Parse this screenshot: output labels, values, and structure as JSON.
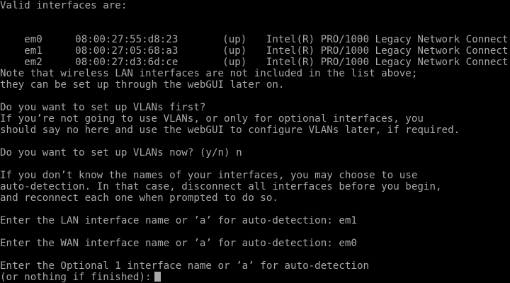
{
  "console": {
    "header": "Valid interfaces are:",
    "interfaces": [
      {
        "name": "em0",
        "mac": "08:00:27:55:d8:23",
        "status": "(up)",
        "desc": "Intel(R) PRO/1000 Legacy Network Connect..."
      },
      {
        "name": "em1",
        "mac": "08:00:27:05:68:a3",
        "status": "(up)",
        "desc": "Intel(R) PRO/1000 Legacy Network Connect..."
      },
      {
        "name": "em2",
        "mac": "08:00:27:d3:6d:ce",
        "status": "(up)",
        "desc": "Intel(R) PRO/1000 Legacy Network Connect..."
      }
    ],
    "wireless_note_1": "Note that wireless LAN interfaces are not included in the list above;",
    "wireless_note_2": "they can be set up through the webGUI later on.",
    "vlan_q1": "Do you want to set up VLANs first?",
    "vlan_q2": "If you’re not going to use VLANs, or only for optional interfaces, you",
    "vlan_q3": "should say no here and use the webGUI to configure VLANs later, if required.",
    "vlan_prompt": "Do you want to set up VLANs now? (y/n) n",
    "auto_1": "If you don’t know the names of your interfaces, you may choose to use",
    "auto_2": "auto-detection. In that case, disconnect all interfaces before you begin,",
    "auto_3": "and reconnect each one when prompted to do so.",
    "lan_prompt": "Enter the LAN interface name or ’a’ for auto-detection: em1",
    "wan_prompt": "Enter the WAN interface name or ’a’ for auto-detection: em0",
    "opt_prompt_1": "Enter the Optional 1 interface name or ’a’ for auto-detection",
    "opt_prompt_2": "(or nothing if finished):"
  },
  "colors": {
    "background": "#000000",
    "text": "#a8a8a8"
  }
}
